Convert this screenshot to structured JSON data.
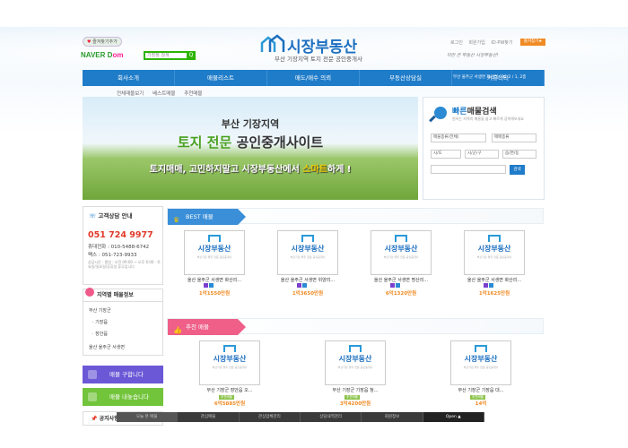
{
  "header": {
    "favorite_label": "즐겨찾기추가",
    "naver_label": "NAVER",
    "naver_dom": "D",
    "naver_om": "om",
    "naver_search_placeholder": "기장정 검색",
    "naver_search_button": "Q",
    "logo_text": "시장부동산",
    "slogan": "부산 기장지역 토지 전문 공인중개사",
    "top_links": [
      "로그인",
      "회원가입",
      "ID·PW찾기"
    ],
    "top_button": "즐겨찾기★",
    "phrase": "이만 큰 부동산 시장부동산!"
  },
  "nav": {
    "items": [
      "회사소개",
      "매물리스트",
      "매도/매수 의뢰",
      "부동산상담실",
      "커뮤니티"
    ],
    "sub_text": "부산 울주군 서생면 화산리 692-2 / 1, 2층"
  },
  "subnav": [
    "전체매물보기",
    "베스트매물",
    "추천매물"
  ],
  "banner": {
    "line1": "부산 기장지역",
    "line2_green": "토지 전문",
    "line2_rest": " 공인중개사이트",
    "line3_a": "토지매매, 고민하지말고 시장부동산에서 ",
    "line3_yellow": "스마트",
    "line3_b": "하게 !"
  },
  "quick_search": {
    "title_blue": "빠른",
    "title_rest": "매물검색",
    "desc": "원하는 지역의 매물을 쉽고 빠르게 검색해보세요",
    "select_type": "매물종류(전체)",
    "select_deal": "매매종류",
    "select_city": "시/도",
    "select_gu": "시/군/구",
    "select_dong": "읍/면/동",
    "button": "검색"
  },
  "customer": {
    "title": "고객상담 안내",
    "number": "051 724 9977",
    "mobile_label": "휴대전화",
    "mobile": "010-5488-6742",
    "fax_label": "팩스",
    "fax": "051-723-9933",
    "hours": "상담시간 · 평일 : 오전 09:00 ~ 오후 6:00 · 토요일/일요일/공휴일 휴무입니다"
  },
  "region": {
    "title": "지역별 매물정보",
    "items": [
      "부산 기장군",
      "· 기장읍",
      "· 장안읍",
      "울산 울주군 서생면"
    ]
  },
  "buttons": {
    "request": "매물 구합니다",
    "offer": "매물 내놓습니다",
    "notice": "공지사항"
  },
  "best": {
    "title": "BEST 매물",
    "cards": [
      {
        "addr": "울산 울주군 서생면 화산리...",
        "price": "1억1550만원"
      },
      {
        "addr": "울산 울주군 서생면 위양리...",
        "price": "1억3650만원"
      },
      {
        "addr": "울산 울주군 서생면 명산리...",
        "price": "6억1320만원"
      },
      {
        "addr": "울산 울주군 서생면 화산리...",
        "price": "1억1625만원"
      }
    ]
  },
  "recommend": {
    "title": "추천 매물",
    "cards": [
      {
        "addr": "부산 기장군 장안읍 오...",
        "price": "6억5885만원"
      },
      {
        "addr": "부산 기장군 기장읍 청...",
        "price": "3억4200만원"
      },
      {
        "addr": "부산 기장군 기장읍 대...",
        "price": "14억"
      }
    ]
  },
  "card_logo": "시장부동산",
  "card_sub": "부산기장 울주 전문 공인중개사",
  "card_tag": "추천매물",
  "statusbar": [
    "오늘 본 매물",
    "관심매물",
    "관심업체관리",
    "상담내역관리",
    "회원정보",
    "Open ▲"
  ]
}
